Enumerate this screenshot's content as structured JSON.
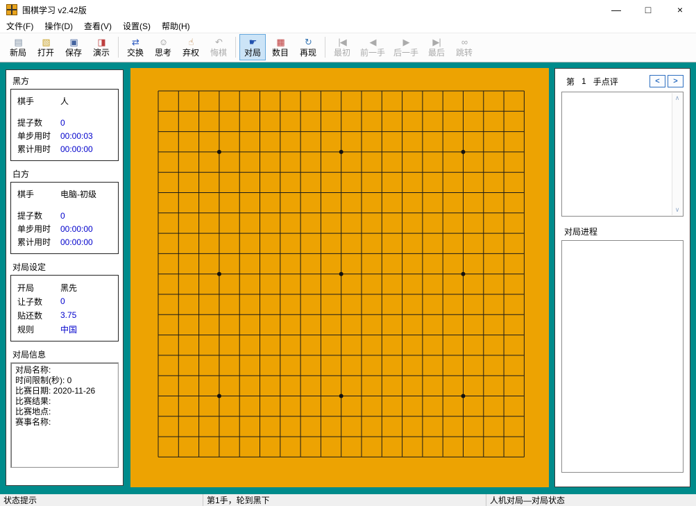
{
  "window": {
    "title": "围棋学习 v2.42版",
    "controls": {
      "minimize": "—",
      "maximize": "□",
      "close": "×"
    }
  },
  "menu": {
    "items": [
      "文件(F)",
      "操作(D)",
      "查看(V)",
      "设置(S)",
      "帮助(H)"
    ]
  },
  "toolbar": {
    "buttons": [
      {
        "label": "新局",
        "icon": "new-game-icon",
        "state": "normal"
      },
      {
        "label": "打开",
        "icon": "open-icon",
        "state": "normal"
      },
      {
        "label": "保存",
        "icon": "save-icon",
        "state": "normal"
      },
      {
        "label": "演示",
        "icon": "demo-icon",
        "state": "normal"
      },
      {
        "separator": true
      },
      {
        "label": "交换",
        "icon": "swap-icon",
        "state": "normal"
      },
      {
        "label": "思考",
        "icon": "think-icon",
        "state": "normal"
      },
      {
        "label": "弃权",
        "icon": "pass-icon",
        "state": "normal"
      },
      {
        "label": "悔棋",
        "icon": "undo-icon",
        "state": "disabled"
      },
      {
        "separator": true
      },
      {
        "label": "对局",
        "icon": "play-icon",
        "state": "active"
      },
      {
        "label": "数目",
        "icon": "count-icon",
        "state": "normal"
      },
      {
        "label": "再现",
        "icon": "replay-icon",
        "state": "normal"
      },
      {
        "separator": true
      },
      {
        "label": "最初",
        "icon": "first-icon",
        "state": "disabled"
      },
      {
        "label": "前一手",
        "icon": "prev-icon",
        "state": "disabled"
      },
      {
        "label": "后一手",
        "icon": "next-icon",
        "state": "disabled"
      },
      {
        "label": "最后",
        "icon": "last-icon",
        "state": "disabled"
      },
      {
        "label": "跳转",
        "icon": "jump-icon",
        "state": "disabled"
      }
    ]
  },
  "left_panel": {
    "black": {
      "title": "黑方",
      "rows": [
        {
          "label": "棋手",
          "value": "人",
          "color": "black"
        },
        {
          "label": "提子数",
          "value": "0",
          "color": "blue"
        },
        {
          "label": "单步用时",
          "value": "00:00:03",
          "color": "blue"
        },
        {
          "label": "累计用时",
          "value": "00:00:00",
          "color": "blue"
        }
      ]
    },
    "white": {
      "title": "白方",
      "rows": [
        {
          "label": "棋手",
          "value": "电脑-初级",
          "color": "black"
        },
        {
          "label": "提子数",
          "value": "0",
          "color": "blue"
        },
        {
          "label": "单步用时",
          "value": "00:00:00",
          "color": "blue"
        },
        {
          "label": "累计用时",
          "value": "00:00:00",
          "color": "blue"
        }
      ]
    },
    "settings": {
      "title": "对局设定",
      "rows": [
        {
          "label": "开局",
          "value": "黑先",
          "color": "black"
        },
        {
          "label": "让子数",
          "value": "0",
          "color": "blue"
        },
        {
          "label": "贴还数",
          "value": "3.75",
          "color": "blue"
        },
        {
          "label": "规则",
          "value": "中国",
          "color": "blue"
        }
      ]
    },
    "info": {
      "title": "对局信息",
      "lines": [
        "对局名称:",
        "时间限制(秒): 0",
        "比赛日期: 2020-11-26",
        "比赛结果:",
        "比赛地点:",
        "赛事名称:"
      ]
    }
  },
  "board": {
    "size": 19,
    "star_points": [
      [
        3,
        3
      ],
      [
        9,
        3
      ],
      [
        15,
        3
      ],
      [
        3,
        9
      ],
      [
        9,
        9
      ],
      [
        15,
        9
      ],
      [
        3,
        15
      ],
      [
        9,
        15
      ],
      [
        15,
        15
      ]
    ],
    "stones": []
  },
  "right_panel": {
    "review": {
      "prefix": "第",
      "move_number": "1",
      "suffix": "手点评",
      "prev_label": "<",
      "next_label": ">",
      "content": ""
    },
    "progress": {
      "title": "对局进程",
      "content": ""
    }
  },
  "status_bar": {
    "left": "状态提示",
    "center": "第1手，轮到黑下",
    "right": "人机对局—对局状态"
  },
  "colors": {
    "desktop_background": "#008B8B",
    "board_background": "#EDA302",
    "value_text": "#0000CC",
    "active_button_background": "#CCE4F7",
    "active_button_border": "#66A8DC"
  }
}
